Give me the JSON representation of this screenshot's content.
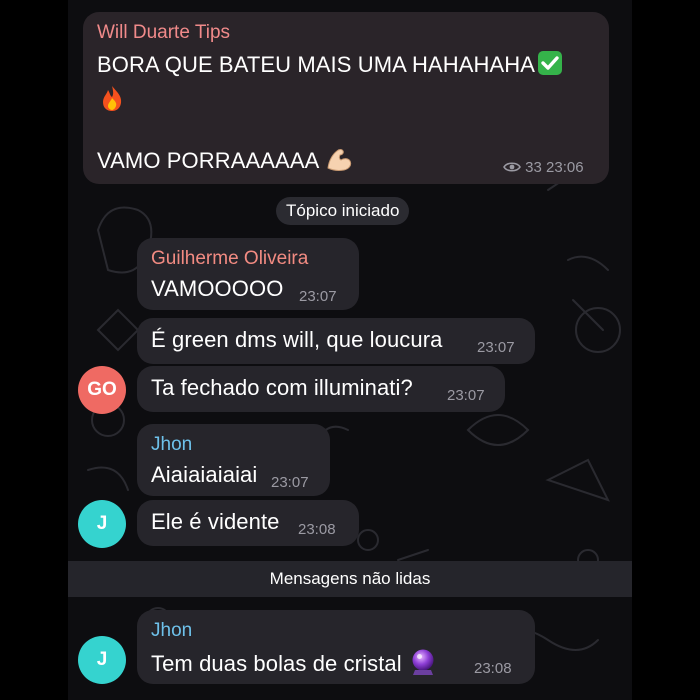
{
  "channel_post": {
    "sender": "Will Duarte Tips",
    "line1": "BORA QUE BATEU MAIS UMA HAHAHAHA",
    "line2": "VAMO PORRAAAAAA",
    "views": "33",
    "time": "23:06"
  },
  "topic_pill": "Tópico iniciado",
  "group1": {
    "sender": "Guilherme Oliveira",
    "avatar_initials": "GO",
    "messages": [
      {
        "text": "VAMOOOOO",
        "time": "23:07"
      },
      {
        "text": "É green dms will, que loucura",
        "time": "23:07"
      },
      {
        "text": "Ta fechado com illuminati?",
        "time": "23:07"
      }
    ]
  },
  "group2": {
    "sender": "Jhon",
    "avatar_initials": "J",
    "messages": [
      {
        "text": "Aiaiaiaiaiai",
        "time": "23:07"
      },
      {
        "text": "Ele é vidente",
        "time": "23:08"
      }
    ]
  },
  "unread_divider": "Mensagens não lidas",
  "group3": {
    "sender": "Jhon",
    "avatar_initials": "J",
    "messages": [
      {
        "text": "Tem duas bolas de cristal",
        "time": "23:08"
      }
    ]
  },
  "icons": [
    "eye-icon",
    "check-mark-emoji",
    "fire-emoji",
    "flexed-biceps-emoji",
    "crystal-ball-emoji"
  ],
  "colors": {
    "channel_sender": "#f08a8a",
    "guilherme_sender": "#f28b82",
    "jhon_sender": "#6ec1ea",
    "avatar_go": "#ef6a63",
    "avatar_j": "#35d3cf"
  }
}
